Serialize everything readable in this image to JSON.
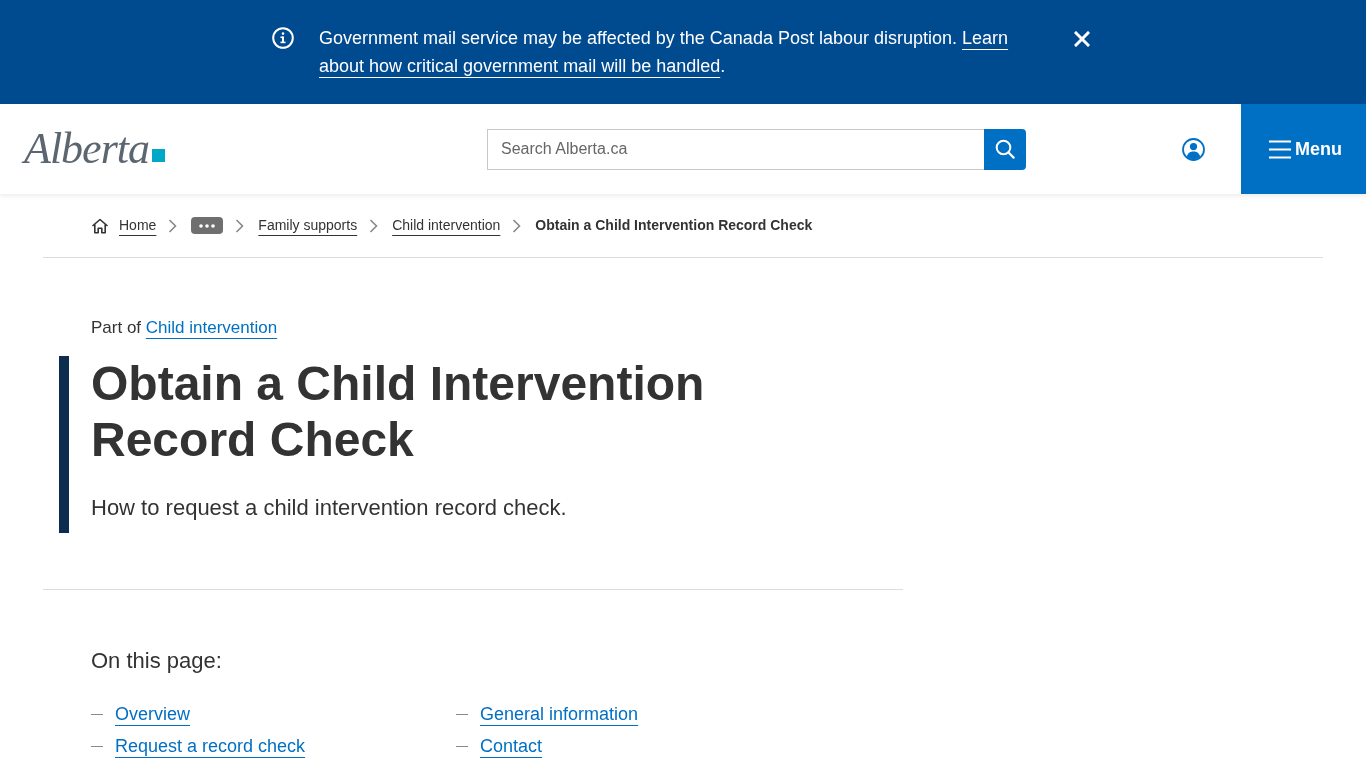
{
  "alert_banner": {
    "message": "Government mail service may be affected by the Canada Post labour disruption.",
    "link_lines": [
      "Learn",
      "about how critical government mail will be handled"
    ],
    "trailing": "."
  },
  "header": {
    "logo_text": "Alberta",
    "search": {
      "placeholder": "Search Alberta.ca"
    },
    "menu_button": "Menu"
  },
  "breadcrumb": [
    {
      "kind": "home",
      "label": "Home"
    },
    {
      "kind": "ellipsis"
    },
    {
      "kind": "link",
      "label": "Family supports"
    },
    {
      "kind": "link",
      "label": "Child intervention"
    },
    {
      "kind": "current",
      "label": "Obtain a Child Intervention Record Check"
    }
  ],
  "page": {
    "part_of_label": "Part of",
    "part_of_link": "Child intervention",
    "title": "Obtain a Child Intervention Record Check",
    "subtitle": "How to request a child intervention record check."
  },
  "on_this_page": {
    "heading": "On this page:",
    "links": [
      "Overview",
      "General information",
      "Request a record check",
      "Contact"
    ]
  }
}
